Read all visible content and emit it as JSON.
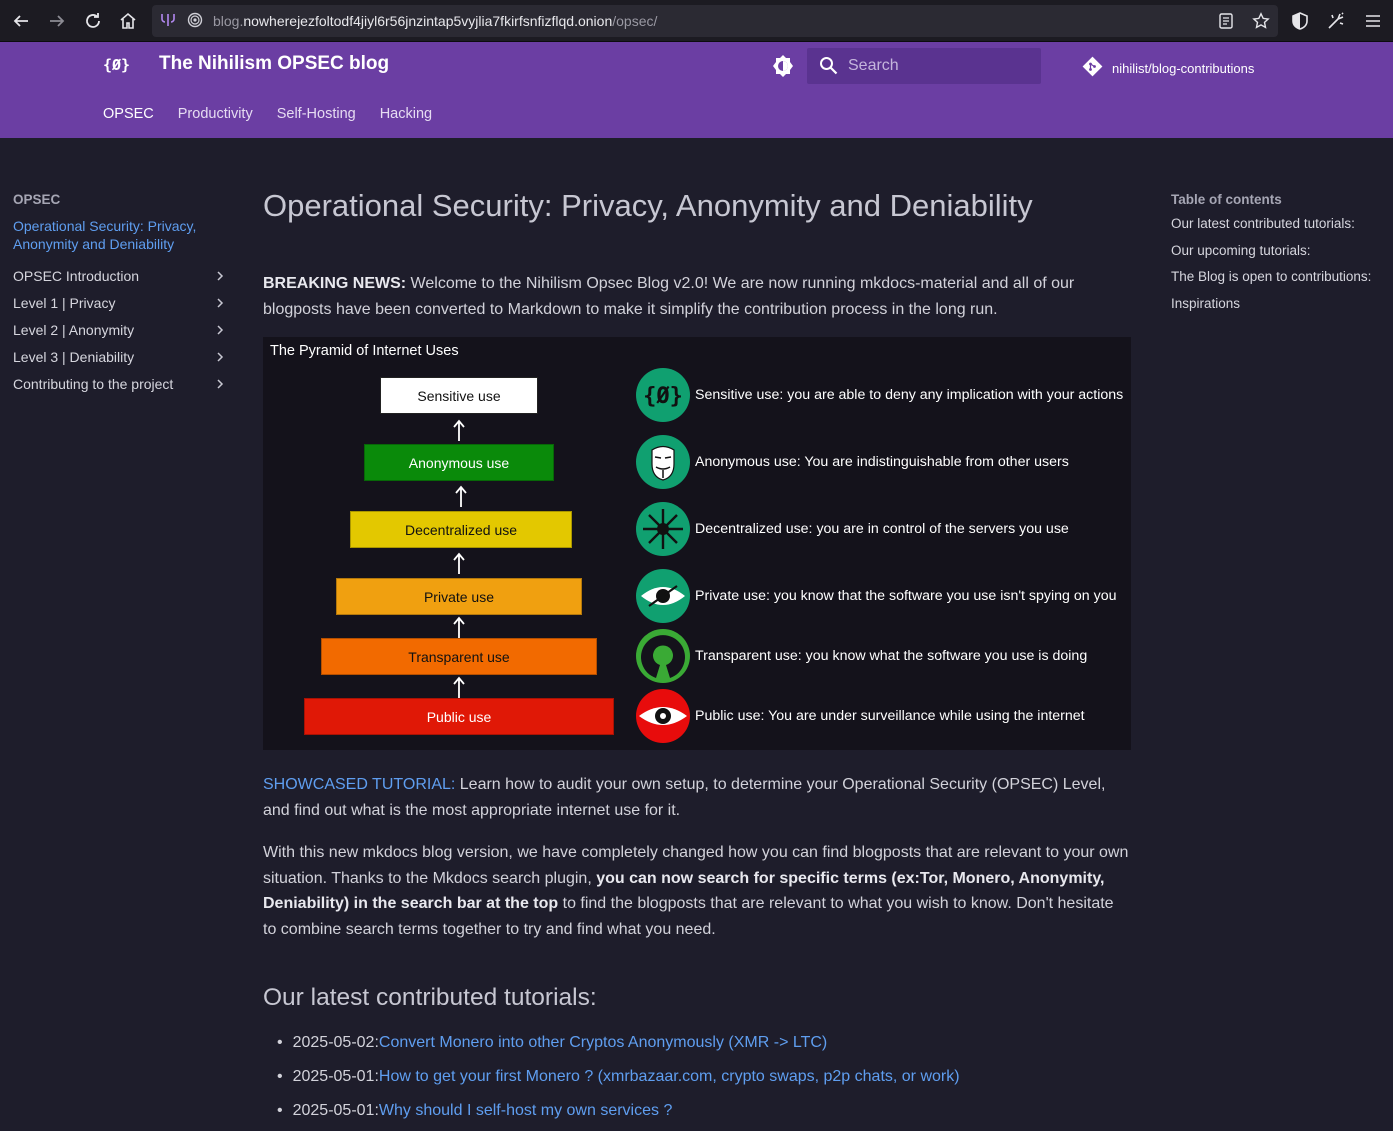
{
  "browser": {
    "url_prefix": "blog.",
    "url_host": "nowherejezfoltodf4jiyl6r56jnzintap5vyjlia7fkirfsnfizflqd.onion",
    "url_path": "/opsec/"
  },
  "header": {
    "logo_text": "{Ø}",
    "site_title": "The Nihilism OPSEC blog",
    "search_placeholder": "Search",
    "repo_label": "nihilist/blog-contributions",
    "tabs": [
      {
        "label": "OPSEC"
      },
      {
        "label": "Productivity"
      },
      {
        "label": "Self-Hosting"
      },
      {
        "label": "Hacking"
      }
    ]
  },
  "sidebar": {
    "title": "OPSEC",
    "active": "Operational Security: Privacy, Anonymity and Deniability",
    "items": [
      {
        "label": "OPSEC Introduction"
      },
      {
        "label": "Level 1 | Privacy"
      },
      {
        "label": "Level 2 | Anonymity"
      },
      {
        "label": "Level 3 | Deniability"
      },
      {
        "label": "Contributing to the project"
      }
    ]
  },
  "toc": {
    "title": "Table of contents",
    "items": [
      {
        "label": "Our latest contributed tutorials:"
      },
      {
        "label": "Our upcoming tutorials:"
      },
      {
        "label": "The Blog is open to contributions:"
      },
      {
        "label": "Inspirations"
      }
    ]
  },
  "content": {
    "title": "Operational Security: Privacy, Anonymity and Deniability",
    "breaking_label": "BREAKING NEWS:",
    "breaking_text": " Welcome to the Nihilism Opsec Blog v2.0! We are now running mkdocs-material and all of our blogposts have been converted to Markdown to make it simplify the contribution process in the long run.",
    "showcase_link": "SHOWCASED TUTORIAL:",
    "showcase_text": " Learn how to audit your own setup, to determine your Operational Security (OPSEC) Level, and find out what is the most appropriate internet use for it.",
    "p3_a": "With this new mkdocs blog version, we have completely changed how you can find blogposts that are relevant to your own situation. Thanks to the Mkdocs search plugin, ",
    "p3_bold": "you can now search for specific terms (ex:Tor, Monero, Anonymity, Deniability) in the search bar at the top",
    "p3_b": " to find the blogposts that are relevant to what you wish to know. Don't hesitate to combine search terms together to try and find what you need.",
    "section_title": "Our latest contributed tutorials:",
    "tutorials": [
      {
        "date": "2025-05-02: ",
        "title": "Convert Monero into other Cryptos Anonymously (XMR -> LTC)"
      },
      {
        "date": "2025-05-01: ",
        "title": "How to get your first Monero ? (xmrbazaar.com, crypto swaps, p2p chats, or work)"
      },
      {
        "date": "2025-05-01: ",
        "title": "Why should I self-host my own services ?"
      }
    ]
  },
  "pyramid": {
    "title": "The Pyramid of Internet Uses",
    "tiers": [
      {
        "label": "Sensitive use",
        "color": "#ffffff",
        "text_color": "#111111"
      },
      {
        "label": "Anonymous use",
        "color": "#0a8a0a",
        "text_color": "#ffffff"
      },
      {
        "label": "Decentralized use",
        "color": "#e3c800",
        "text_color": "#111111"
      },
      {
        "label": "Private use",
        "color": "#f0a010",
        "text_color": "#111111"
      },
      {
        "label": "Transparent use",
        "color": "#f26a00",
        "text_color": "#111111"
      },
      {
        "label": "Public use",
        "color": "#e01806",
        "text_color": "#ffffff"
      }
    ],
    "legend": [
      {
        "icon": "nihilism-logo-icon",
        "text": "Sensitive use: you are able to deny any implication with your actions"
      },
      {
        "icon": "guy-fawkes-mask-icon",
        "text": "Anonymous use: You are indistinguishable from other users"
      },
      {
        "icon": "chaos-star-icon",
        "text": "Decentralized use: you are in control of the servers you use"
      },
      {
        "icon": "crossed-eye-icon",
        "text": "Private use: you know that the software you use isn't spying on you"
      },
      {
        "icon": "open-source-icon",
        "text": "Transparent use: you know what the software you use is doing"
      },
      {
        "icon": "surveillance-eye-icon",
        "text": "Public use: You are under surveillance while using the internet"
      }
    ]
  }
}
